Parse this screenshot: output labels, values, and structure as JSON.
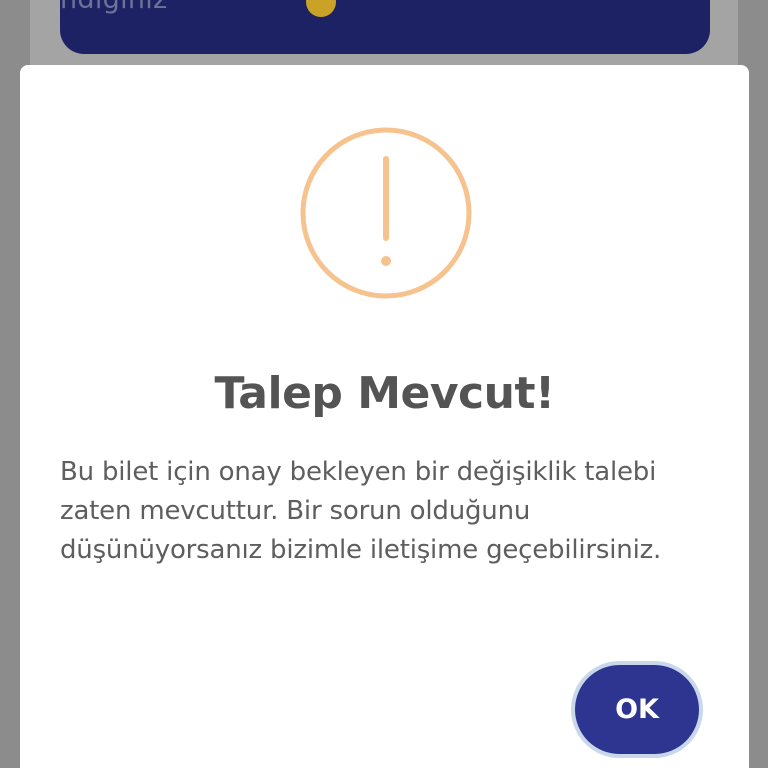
{
  "background": {
    "banner_text": "ndığınız",
    "banner_emoji_icon": "smiling-face-emoji"
  },
  "dialog": {
    "icon": "exclamation-circle-icon",
    "icon_color": "#f6c38e",
    "title": "Talep Mevcut!",
    "message": "Bu bilet için onay bekleyen bir değişiklik talebi zaten mevcuttur. Bir sorun olduğunu düşünüyorsanız bizimle iletişime geçebilirsiniz.",
    "ok_label": "OK",
    "ok_color": "#2e3590"
  }
}
